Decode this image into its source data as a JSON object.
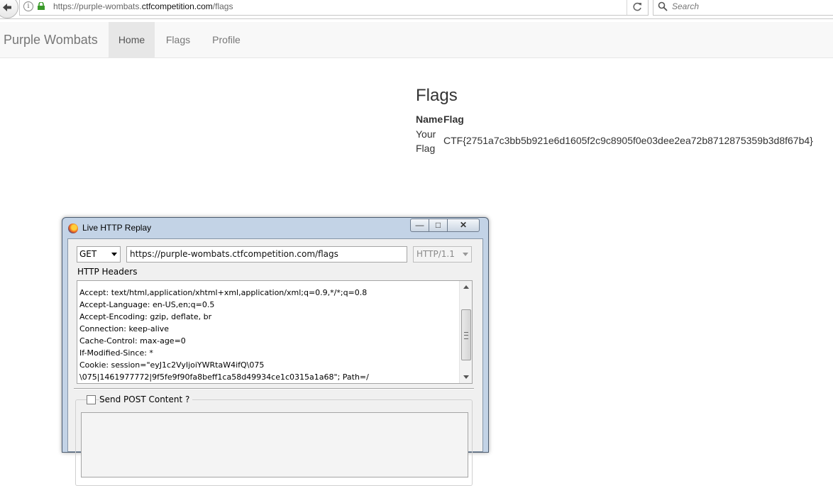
{
  "browser": {
    "url_prefix": "https://purple-wombats.",
    "url_domain": "ctfcompetition.com",
    "url_path": "/flags",
    "search_placeholder": "Search"
  },
  "navbar": {
    "brand": "Purple Wombats",
    "items": [
      {
        "label": "Home",
        "active": true
      },
      {
        "label": "Flags",
        "active": false
      },
      {
        "label": "Profile",
        "active": false
      }
    ]
  },
  "page": {
    "title": "Flags",
    "table": {
      "headers": [
        "Name",
        "Flag"
      ],
      "rows": [
        {
          "name": "Your Flag",
          "flag": "CTF{2751a7c3bb5b921e6d1605f2c9c8905f0e03dee2ea72b8712875359b3d8f67b4}"
        }
      ]
    }
  },
  "replay_window": {
    "title": "Live HTTP Replay",
    "method": "GET",
    "url": "https://purple-wombats.ctfcompetition.com/flags",
    "protocol": "HTTP/1.1",
    "headers_label": "HTTP Headers",
    "header_lines": [
      "Accept: text/html,application/xhtml+xml,application/xml;q=0.9,*/*;q=0.8",
      "Accept-Language: en-US,en;q=0.5",
      "Accept-Encoding: gzip, deflate, br",
      "Connection: keep-alive",
      "Cache-Control: max-age=0",
      "If-Modified-Since: *",
      "Cookie: session=\"eyJ1c2VyIjoiYWRtaW4ifQ\\075",
      "\\075|1461977772|9f5fe9f90fa8beff1ca58d49934ce1c0315a1a68\"; Path=/"
    ],
    "post_label": "Send POST Content ?",
    "post_checked": false
  },
  "colors": {
    "navbar_bg": "#f8f8f8",
    "active_tab_bg": "#e7e7e7",
    "window_frame": "#c3d3e6"
  }
}
